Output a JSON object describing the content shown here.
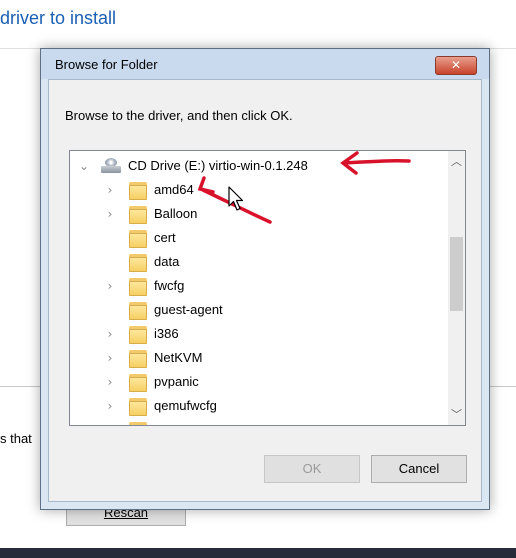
{
  "background": {
    "title": "driver to install",
    "partial_text": "s that",
    "rescan_label": "Rescan"
  },
  "dialog": {
    "title": "Browse for Folder",
    "instruction": "Browse to the driver, and then click OK.",
    "close_symbol": "✕",
    "ok_label": "OK",
    "cancel_label": "Cancel",
    "ok_enabled": false
  },
  "tree": {
    "root": {
      "label": "CD Drive (E:) virtio-win-0.1.248",
      "icon": "cd-drive-icon",
      "expanded": true
    },
    "items": [
      {
        "label": "amd64",
        "expandable": true
      },
      {
        "label": "Balloon",
        "expandable": true
      },
      {
        "label": "cert",
        "expandable": false
      },
      {
        "label": "data",
        "expandable": false
      },
      {
        "label": "fwcfg",
        "expandable": true
      },
      {
        "label": "guest-agent",
        "expandable": false
      },
      {
        "label": "i386",
        "expandable": true
      },
      {
        "label": "NetKVM",
        "expandable": true
      },
      {
        "label": "pvpanic",
        "expandable": true
      },
      {
        "label": "qemufwcfg",
        "expandable": true
      }
    ]
  },
  "colors": {
    "annotation_arrow": "#d9122b",
    "link_blue": "#1a5fb4",
    "close_button": "#c7432b"
  }
}
